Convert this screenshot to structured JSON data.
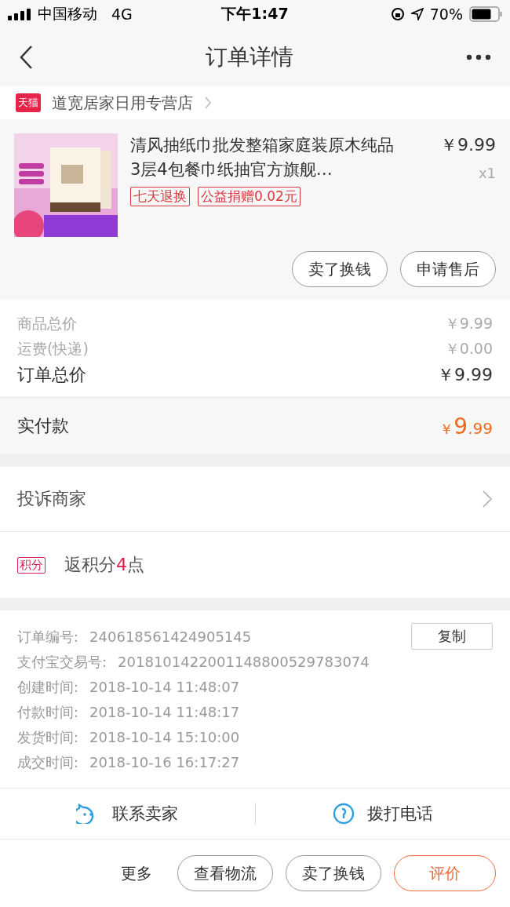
{
  "status_bar": {
    "carrier": "中国移动",
    "network": "4G",
    "time": "下午1:47",
    "battery": "70%"
  },
  "nav": {
    "title": "订单详情"
  },
  "shop": {
    "badge": "天猫",
    "name": "道宽居家日用专营店"
  },
  "product": {
    "title": "清风抽纸巾批发整箱家庭装原木纯品3层4包餐巾纸抽官方旗舰…",
    "price": "￥9.99",
    "quantity": "x1",
    "tags": [
      "七天退换",
      "公益捐赠0.02元"
    ],
    "actions": [
      "卖了换钱",
      "申请售后"
    ]
  },
  "summary": [
    {
      "label": "商品总价",
      "value": "￥9.99",
      "kind": "minor"
    },
    {
      "label": "运费(快递)",
      "value": "￥0.00",
      "kind": "minor"
    },
    {
      "label": "订单总价",
      "value": "￥9.99",
      "kind": "major"
    }
  ],
  "paid": {
    "label": "实付款",
    "currency": "￥",
    "integer": "9",
    "decimals": ".99"
  },
  "complaint": {
    "label": "投诉商家"
  },
  "points": {
    "badge": "积分",
    "prefix": "返积分",
    "count": "4",
    "suffix": "点"
  },
  "info": {
    "copy_button": "复制",
    "rows": [
      {
        "label": "订单编号:",
        "value": "240618561424905145"
      },
      {
        "label": "支付宝交易号:",
        "value": "2018101422001148800529783074"
      },
      {
        "label": "创建时间:",
        "value": "2018-10-14 11:48:07"
      },
      {
        "label": "付款时间:",
        "value": "2018-10-14 11:48:17"
      },
      {
        "label": "发货时间:",
        "value": "2018-10-14 15:10:00"
      },
      {
        "label": "成交时间:",
        "value": "2018-10-16 16:17:27"
      }
    ]
  },
  "contact": [
    {
      "label": "联系卖家",
      "kind": "chat"
    },
    {
      "label": "拨打电话",
      "kind": "phone"
    }
  ],
  "bottom_bar": {
    "more": "更多",
    "buttons": [
      {
        "label": "查看物流",
        "kind": "normal"
      },
      {
        "label": "卖了换钱",
        "kind": "normal"
      },
      {
        "label": "评价",
        "kind": "primary"
      }
    ]
  }
}
